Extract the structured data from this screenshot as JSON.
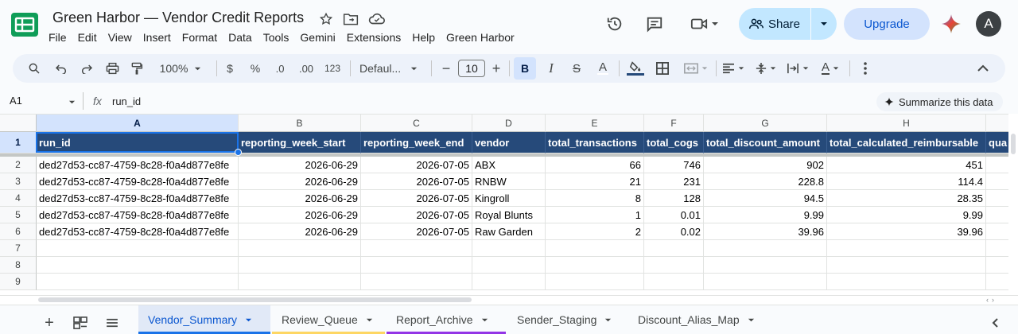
{
  "title": "Green Harbor — Vendor Credit Reports",
  "menu": [
    "File",
    "Edit",
    "View",
    "Insert",
    "Format",
    "Data",
    "Tools",
    "Gemini",
    "Extensions",
    "Help",
    "Green Harbor"
  ],
  "header_buttons": {
    "share": "Share",
    "upgrade": "Upgrade",
    "avatar": "A"
  },
  "toolbar": {
    "zoom": "100%",
    "currency": "$",
    "percent": "%",
    "dec_dec": ".0",
    "inc_dec": ".00",
    "format_123": "123",
    "font": "Defaul...",
    "font_size": "10"
  },
  "formula_bar": {
    "cell_ref": "A1",
    "fx": "fx",
    "value": "run_id",
    "summarize": "Summarize this data"
  },
  "columns": [
    "A",
    "B",
    "C",
    "D",
    "E",
    "F",
    "G",
    "H"
  ],
  "rows": [
    "1",
    "2",
    "3",
    "4",
    "5",
    "6",
    "7",
    "8",
    "9"
  ],
  "header_row": [
    "run_id",
    "reporting_week_start",
    "reporting_week_end",
    "vendor",
    "total_transactions",
    "total_cogs",
    "total_discount_amount",
    "total_calculated_reimbursable",
    "qua"
  ],
  "data_rows": [
    [
      "ded27d53-cc87-4759-8c28-f0a4d877e8fe",
      "2026-06-29",
      "2026-07-05",
      "ABX",
      "66",
      "746",
      "902",
      "451"
    ],
    [
      "ded27d53-cc87-4759-8c28-f0a4d877e8fe",
      "2026-06-29",
      "2026-07-05",
      "RNBW",
      "21",
      "231",
      "228.8",
      "114.4"
    ],
    [
      "ded27d53-cc87-4759-8c28-f0a4d877e8fe",
      "2026-06-29",
      "2026-07-05",
      "Kingroll",
      "8",
      "128",
      "94.5",
      "28.35"
    ],
    [
      "ded27d53-cc87-4759-8c28-f0a4d877e8fe",
      "2026-06-29",
      "2026-07-05",
      "Royal Blunts",
      "1",
      "0.01",
      "9.99",
      "9.99"
    ],
    [
      "ded27d53-cc87-4759-8c28-f0a4d877e8fe",
      "2026-06-29",
      "2026-07-05",
      "Raw Garden",
      "2",
      "0.02",
      "39.96",
      "39.96"
    ]
  ],
  "sheet_tabs": [
    {
      "label": "Vendor_Summary",
      "color": "#1a73e8",
      "active": true
    },
    {
      "label": "Review_Queue",
      "color": "#fdd663"
    },
    {
      "label": "Report_Archive",
      "color": "#9334e6"
    },
    {
      "label": "Sender_Staging",
      "color": ""
    },
    {
      "label": "Discount_Alias_Map",
      "color": ""
    }
  ],
  "colors": {
    "header_fill": "#264a7a",
    "selection": "#1a73e8",
    "share_bg": "#c2e7ff"
  }
}
